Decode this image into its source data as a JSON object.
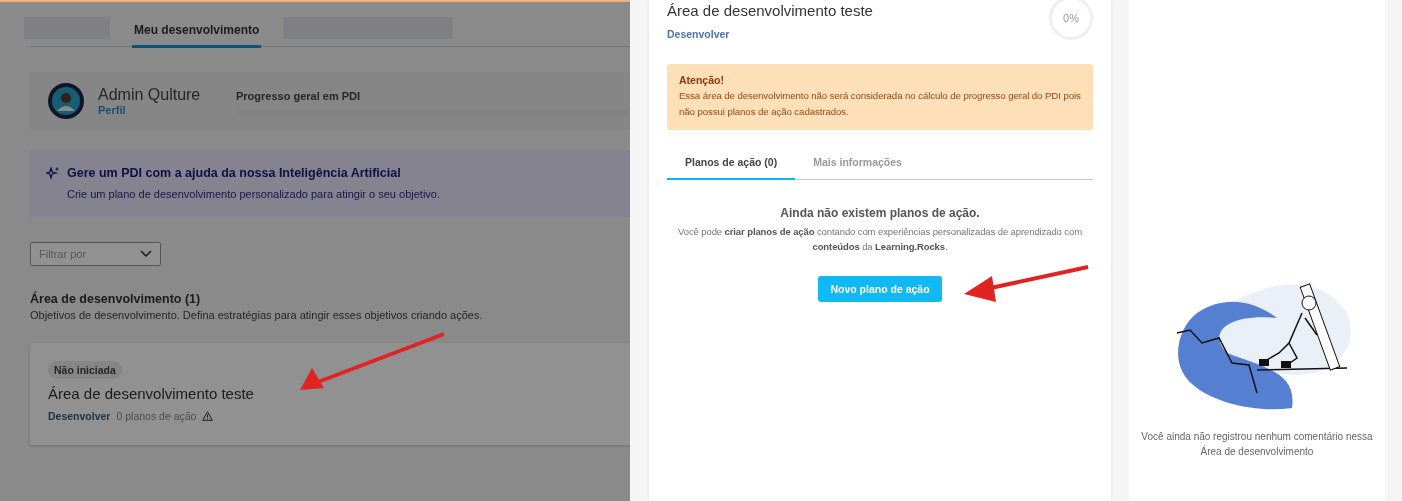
{
  "page": {
    "tabs": [
      {
        "label": "Meu desenvolvimento",
        "selected": true
      }
    ],
    "profile": {
      "name": "Admin Qulture",
      "link": "Perfil",
      "progress_label": "Progresso geral em PDI",
      "level": 0
    },
    "ai_banner": {
      "title": "Gere um PDI com a ajuda da nossa Inteligência Artificial",
      "text": "Crie um plano de desenvolvimento personalizado para atingir o seu objetivo."
    },
    "filter": {
      "placeholder": "Filtrar por"
    },
    "section": {
      "title": "Área de desenvolvimento (1)",
      "subtitle": "Objetivos de desenvolvimento. Defina estratégias para atingir esses objetivos criando ações."
    },
    "areas": [
      {
        "status": "Não iniciada",
        "title": "Área de desenvolvimento teste",
        "category": "Desenvolver",
        "plans": "0 planos de ação",
        "warning": true
      }
    ]
  },
  "drawer": {
    "title": "Área de desenvolvimento teste",
    "category": "Desenvolver",
    "progress": {
      "label": "0%"
    },
    "alert": {
      "title": "Atenção!",
      "text": "Essa área de desenvolvimento não será considerada no cálculo de progresso geral do PDI pois não possui planos de ação cadastrados."
    },
    "tabs": [
      {
        "label": "Planos de ação (0)",
        "selected": true
      },
      {
        "label": "Mais informações",
        "selected": false
      }
    ],
    "empty": {
      "title": "Ainda não existem planos de ação.",
      "text": "Você pode **criar planos de ação** contando com experiências personalizadas de aprendizado com **conteúdos** da **Learning.Rocks**."
    },
    "button": "Novo plano de ação"
  },
  "comments": {
    "empty_text": "Você ainda não registrou nenhum comentário nessa Área de desenvolvimento"
  }
}
